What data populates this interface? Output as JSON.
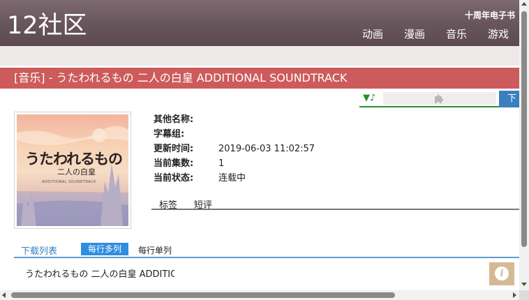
{
  "header": {
    "logo": "12社区",
    "ebook_link": "十周年电子书",
    "nav": [
      "动画",
      "漫画",
      "音乐",
      "游戏"
    ]
  },
  "title": "[音乐] - うたわれるもの 二人の白皇 ADDITIONAL SOUNDTRACK",
  "player": {
    "play_icon": "▼♪",
    "plugin_icon": "puzzle-icon",
    "download_button": "下"
  },
  "cover": {
    "title": "うたわれるもの",
    "subtitle": "二人の白皇",
    "small_text": "ADDITIONAL SOUNDTRACK"
  },
  "info": [
    {
      "label": "其他名称:",
      "value": ""
    },
    {
      "label": "字幕组:",
      "value": ""
    },
    {
      "label": "更新时间:",
      "value": "2019-06-03 11:02:57"
    },
    {
      "label": "当前集数:",
      "value": "1"
    },
    {
      "label": "当前状态:",
      "value": "连载中"
    }
  ],
  "tabs": [
    "标签",
    "短评"
  ],
  "download_list": {
    "title": "下载列表",
    "mode_multi": "每行多列",
    "mode_single": "每行单列"
  },
  "episode": "うたわれるもの 二人の白皇 ADDITIONAL SOUNDTRACK",
  "info_badge": "i",
  "colors": {
    "header": "#67555b",
    "title_bar": "#cd5b5b",
    "accent_blue": "#2f8de0",
    "player_green": "#2e8b2e",
    "badge": "#d5b995"
  }
}
